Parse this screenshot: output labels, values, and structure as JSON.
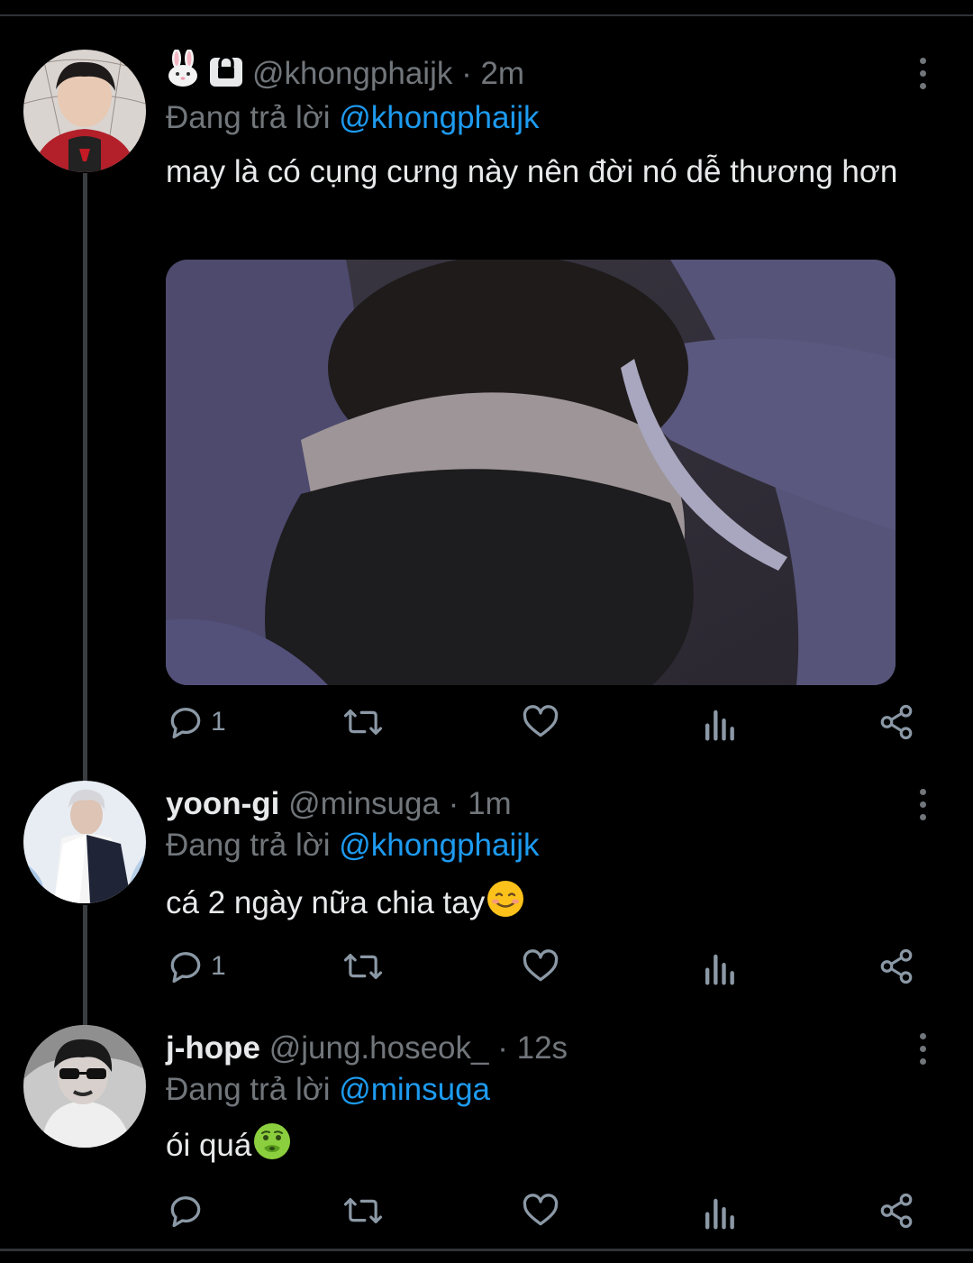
{
  "tweets": [
    {
      "name": "",
      "handle": "@khongphaijk",
      "dot": "·",
      "time": "2m",
      "name_icons": [
        "rabbit-face-icon",
        "lock-icon"
      ],
      "replying_prefix": "Đang trả lời",
      "replying_to": "@khongphaijk",
      "text": "may là có cụng cưng này nên đời nó dễ thương hơn",
      "has_media": true,
      "reply_count": "1",
      "retweet_count": "",
      "like_count": ""
    },
    {
      "name": "yoon-gi",
      "handle": "@minsuga",
      "dot": "·",
      "time": "1m",
      "replying_prefix": "Đang trả lời",
      "replying_to": "@khongphaijk",
      "text": "cá 2 ngày nữa chia tay",
      "text_emoji": "smiling-face-icon",
      "reply_count": "1",
      "retweet_count": "",
      "like_count": ""
    },
    {
      "name": "j-hope",
      "handle": "@jung.hoseok_",
      "dot": "·",
      "time": "12s",
      "replying_prefix": "Đang trả lời",
      "replying_to": "@minsuga",
      "text": "ói quá",
      "text_emoji": "nauseated-face-icon",
      "reply_count": "",
      "retweet_count": "",
      "like_count": ""
    }
  ],
  "colors": {
    "background": "#000000",
    "text": "#e7e9ea",
    "secondary": "#71767b",
    "mention": "#1d9bf0",
    "divider": "#2f3336"
  }
}
